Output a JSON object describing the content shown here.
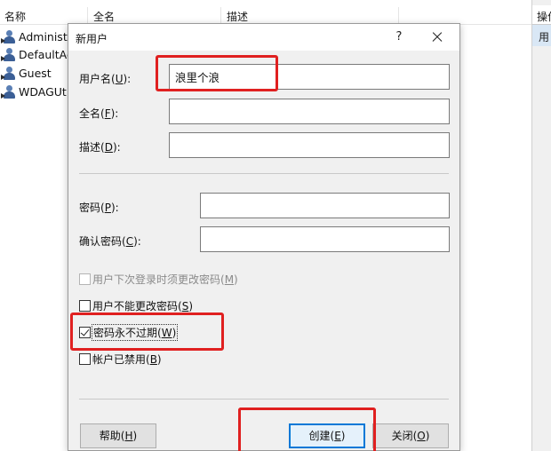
{
  "list": {
    "headers": {
      "name": "名称",
      "full_name": "全名",
      "description": "描述"
    },
    "users": [
      "Administr",
      "DefaultAc",
      "Guest",
      "WDAGUti"
    ]
  },
  "actions_panel": {
    "header": "操作",
    "item": "用"
  },
  "dialog": {
    "title": "新用户",
    "help": "?",
    "fields": {
      "username": {
        "label": "用户名(",
        "key": "U",
        "suffix": "):",
        "value": "浪里个浪"
      },
      "fullname": {
        "label": "全名(",
        "key": "F",
        "suffix": "):",
        "value": ""
      },
      "description": {
        "label": "描述(",
        "key": "D",
        "suffix": "):",
        "value": ""
      },
      "password": {
        "label": "密码(",
        "key": "P",
        "suffix": "):",
        "value": ""
      },
      "confirm": {
        "label": "确认密码(",
        "key": "C",
        "suffix": "):",
        "value": ""
      }
    },
    "options": {
      "must_change": {
        "label": "用户下次登录时须更改密码(",
        "key": "M",
        "suffix": ")",
        "checked": false,
        "disabled": true
      },
      "cannot_change": {
        "label": "用户不能更改密码(",
        "key": "S",
        "suffix": ")",
        "checked": false,
        "disabled": false
      },
      "never_expires": {
        "label": "密码永不过期(",
        "key": "W",
        "suffix": ")",
        "checked": true,
        "disabled": false
      },
      "disabled": {
        "label": "帐户已禁用(",
        "key": "B",
        "suffix": ")",
        "checked": false,
        "disabled": false
      }
    },
    "buttons": {
      "help": {
        "label": "帮助(",
        "key": "H",
        "suffix": ")"
      },
      "create": {
        "label": "创建(",
        "key": "E",
        "suffix": ")"
      },
      "close": {
        "label": "关闭(",
        "key": "O",
        "suffix": ")"
      }
    }
  },
  "colors": {
    "annotation": "#e02020",
    "dialog_bg": "#f0f0f0",
    "default_button_border": "#0078d7"
  }
}
